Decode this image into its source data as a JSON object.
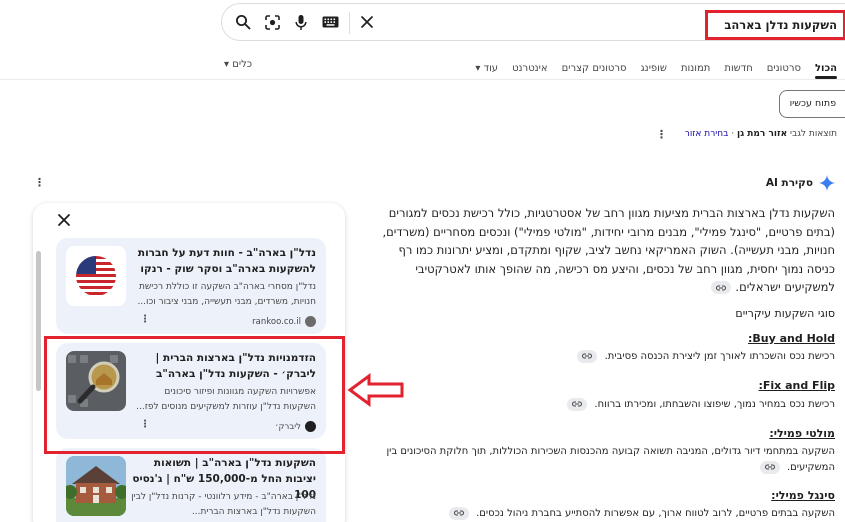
{
  "search": {
    "query": "השקעות נדלן בארהב"
  },
  "tabs": [
    {
      "label": "הכול",
      "active": true
    },
    {
      "label": "סרטונים"
    },
    {
      "label": "חדשות"
    },
    {
      "label": "תמונות"
    },
    {
      "label": "שופינג"
    },
    {
      "label": "סרטונים קצרים"
    },
    {
      "label": "אינטרנט"
    },
    {
      "label": "עוד ▾"
    }
  ],
  "tools_label": "כלים ▾",
  "open_now_label": "פתוח עכשיו",
  "location": {
    "prefix": "תוצאות לגבי",
    "area": "אזור רמת גן",
    "sep": "·",
    "choose": "בחירת אזור"
  },
  "ai_overview": {
    "title": "סקירת AI",
    "paragraph": "השקעות נדלן בארצות הברית מציעות מגוון רחב של אסטרטגיות, כולל רכישת נכסים למגורים (בתים פרטיים, \"סינגל פמילי\", מבנים מרובי יחידות, \"מולטי פמילי\") ונכסים מסחריים (משרדים, חנויות, מבני תעשייה). השוק האמריקאי נחשב לציב, שקוף ומתקדם, ומציע יתרונות כמו רף כניסה נמוך יחסית, מגוון רחב של נכסים, והיצע מס רכישה, מה שהופך אותו לאטרקטיבי למשקיעים ישראלים.",
    "section_title": "סוגי השקעות עיקריים",
    "items": [
      {
        "title": "Buy and Hold:",
        "desc": "רכישת נכס והשכרתו לאורך זמן ליצירת הכנסה פסיבית."
      },
      {
        "title": "Fix and Flip:",
        "desc": "רכישת נכס במחיר נמוך, שיפוצו והשבחתו, ומכירתו ברווח."
      },
      {
        "title": "מולטי פמילי:",
        "desc": "השקעה במתחמי דיור גדולים, המניבה תשואה קבועה מהכנסות השכירות הכוללות, תוך חלוקת הסיכונים בין המשקיעים."
      },
      {
        "title": "סינגל פמילי:",
        "desc": "השקעה בבתים פרטיים, לרוב לטווח ארוך, עם אפשרות להסתייע בחברת ניהול נכסים."
      }
    ]
  },
  "sources": [
    {
      "title": "נדל\"ן בארה\"ב - חוות דעת על חברות להשקעות בארה\"ב וסקר שוק - רנקו",
      "snippet": "נדל\"ן מסחרי בארה\"ב השקעה זו כוללת רכישת חנויות, משרדים, מבני תעשייה, מבני ציבור וכו...",
      "source": "rankoo.co.il",
      "thumb_icon": "us-flag-icon"
    },
    {
      "title": "הזדמנויות נדל\"ן בארצות הברית | ליברק׳ - השקעות נדל\"ן בארה\"ב",
      "snippet": "אפשרויות השקעה מגוונות ופיזור סיכונים השקעות נדל\"ן עוזרות למשקיעים מנוסים לפז...",
      "source": "ליברק׳",
      "thumb_icon": "magnifier-house-icon"
    },
    {
      "title": "השקעות נדל\"ן בארה\"ב | תשואות יציבות החל מ-150,000 ש\"ח | ג'נסיס 100",
      "snippet": "נדל\"ן בארה\"ב - מידע רלוונטי - קרנות נדל\"ן לבין השקעות נדל\"ן בארצות הברית...",
      "source": "",
      "thumb_icon": "house-icon"
    }
  ]
}
